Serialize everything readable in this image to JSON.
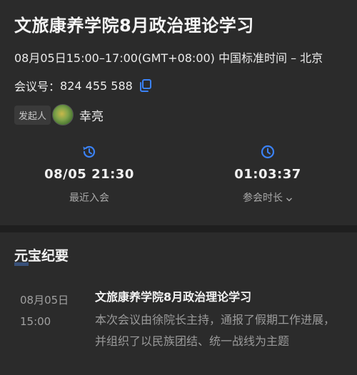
{
  "meeting": {
    "title": "文旅康养学院8月政治理论学习",
    "time_range": "08月05日15:00–17:00(GMT+08:00) 中国标准时间 – 北京",
    "meeting_id_label": "会议号：",
    "meeting_id": "824 455 588",
    "organizer_tag": "发起人",
    "organizer_name": "幸亮"
  },
  "stats": {
    "recent_join_value": "08/05 21:30",
    "recent_join_label": "最近入会",
    "duration_value": "01:03:37",
    "duration_label": "参会时长"
  },
  "summary": {
    "heading": "元宝纪要",
    "entries": [
      {
        "date": "08月05日",
        "time": "15:00",
        "title": "文旅康养学院8月政治理论学习",
        "snippet": "本次会议由徐院长主持，通报了假期工作进展，并组织了以民族团结、统一战线为主题"
      }
    ]
  },
  "colors": {
    "background": "#2b2b2b",
    "accent": "#3b82f6",
    "divider": "#1f1f1f"
  },
  "icons": {
    "copy": "copy-icon",
    "history": "history-clock-icon",
    "clock": "clock-icon",
    "chevron": "chevron-down-icon"
  }
}
